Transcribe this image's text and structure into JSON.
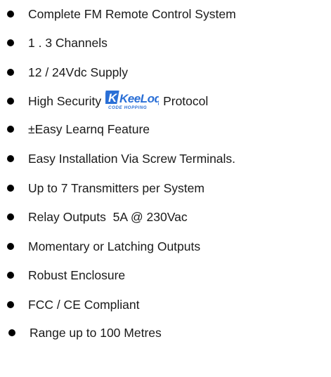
{
  "features": [
    "Complete FM Remote Control System",
    "1 . 3 Channels",
    "12 / 24Vdc Supply",
    "High Security",
    "±Easy Learnq Feature",
    "Easy Installation Via Screw Terminals.",
    "Up to 7 Transmitters per System",
    "Relay Outputs  5A @ 230Vac",
    "Momentary or Latching Outputs",
    "Robust Enclosure",
    "FCC / CE Compliant",
    "Range up to 100 Metres"
  ],
  "keeloq": {
    "logo_text": "KeeLoq",
    "logo_tagline": "CODE HOPPING",
    "suffix": "Protocol",
    "brand_color": "#2a6fd6"
  },
  "bullet_icon": "filled-circle-bullet"
}
